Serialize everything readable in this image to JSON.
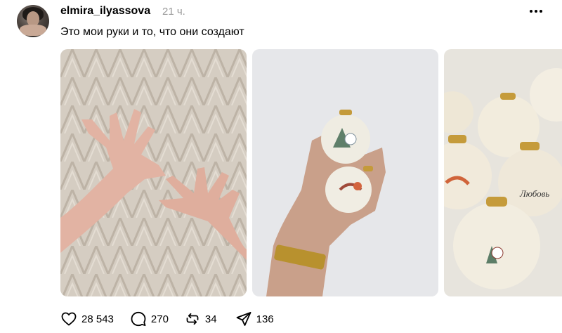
{
  "post": {
    "username": "elmira_ilyassova",
    "time": "21 ч.",
    "text": "Это мои руки и то, что они создают"
  },
  "photos": [
    {
      "subject": "hands-against-wall"
    },
    {
      "subject": "hand-holding-ornament-candles"
    },
    {
      "subject": "ornament-candles-group",
      "visible_text": "Любовь"
    }
  ],
  "icons": {
    "avatar": "profile-photo",
    "more": "more-icon",
    "like": "heart-icon",
    "reply": "comment-icon",
    "repost": "repost-icon",
    "share": "share-icon"
  },
  "stats": {
    "likes": "28 543",
    "replies": "270",
    "reposts": "34",
    "shares": "136"
  },
  "colors": {
    "text": "#000000",
    "muted": "#999999",
    "background": "#ffffff"
  }
}
